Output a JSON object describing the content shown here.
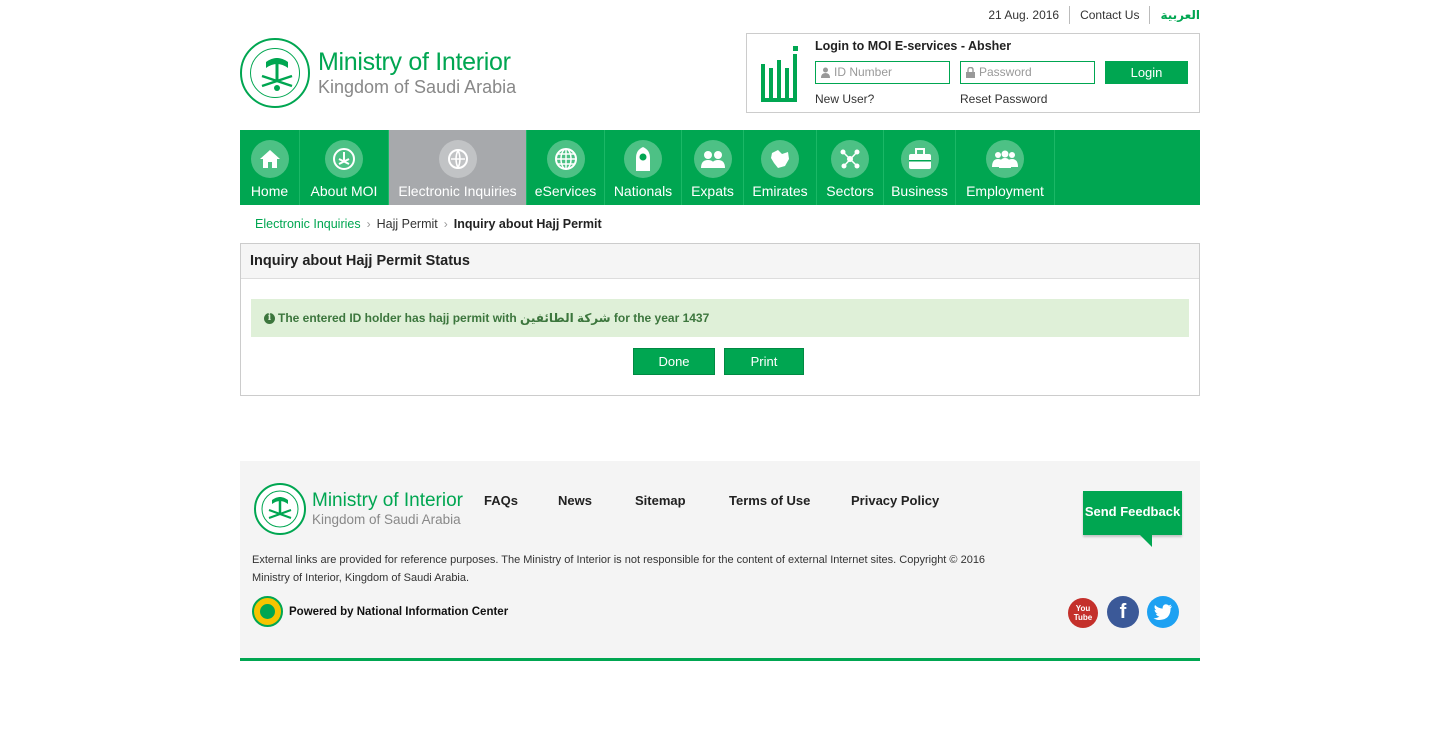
{
  "topbar": {
    "date": "21 Aug. 2016",
    "contact": "Contact Us",
    "language": "العربية"
  },
  "brand": {
    "title": "Ministry of Interior",
    "subtitle": "Kingdom of Saudi Arabia"
  },
  "login": {
    "title": "Login to MOI E-services - Absher",
    "id_placeholder": "ID Number",
    "password_placeholder": "Password",
    "button": "Login",
    "new_user": "New User?",
    "reset_password": "Reset Password"
  },
  "nav": {
    "items": [
      {
        "label": "Home",
        "icon": "home-icon"
      },
      {
        "label": "About MOI",
        "icon": "emblem-icon"
      },
      {
        "label": "Electronic Inquiries",
        "icon": "inquiries-icon",
        "active": true
      },
      {
        "label": "eServices",
        "icon": "globe-icon"
      },
      {
        "label": "Nationals",
        "icon": "person-icon"
      },
      {
        "label": "Expats",
        "icon": "people-icon"
      },
      {
        "label": "Emirates",
        "icon": "map-icon"
      },
      {
        "label": "Sectors",
        "icon": "network-icon"
      },
      {
        "label": "Business",
        "icon": "briefcase-icon"
      },
      {
        "label": "Employment",
        "icon": "group-icon"
      }
    ]
  },
  "breadcrumb": {
    "root": "Electronic Inquiries",
    "middle": "Hajj Permit",
    "current": "Inquiry about Hajj Permit"
  },
  "panel": {
    "title": "Inquiry about Hajj Permit Status",
    "message": "The entered ID holder has hajj permit with شركة الطائفين for the year 1437",
    "done": "Done",
    "print": "Print"
  },
  "footer": {
    "title": "Ministry of Interior",
    "subtitle": "Kingdom of Saudi Arabia",
    "links": [
      "FAQs",
      "News",
      "Sitemap",
      "Terms of Use",
      "Privacy Policy"
    ],
    "feedback": "Send Feedback",
    "disclaimer_line1": "External links are provided for reference purposes. The Ministry of Interior is not responsible for the content of external Internet sites. Copyright © 2016",
    "disclaimer_line2": "Ministry of Interior, Kingdom of Saudi Arabia.",
    "powered_by": "Powered by National Information Center",
    "youtube": "You Tube",
    "facebook": "f"
  },
  "colors": {
    "brand_green": "#00a651",
    "active_nav": "#a7a9ac",
    "alert_bg": "#dff0d8",
    "alert_text": "#3c763d"
  }
}
